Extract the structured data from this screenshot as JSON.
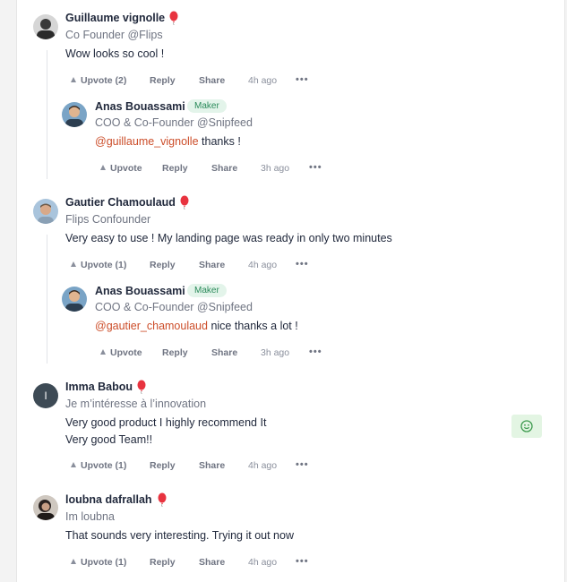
{
  "comments": [
    {
      "author": "Guillaume vignolle",
      "headline": "Co Founder @Flips",
      "text": "Wow looks so cool !",
      "upvote": "Upvote (2)",
      "reply": "Reply",
      "share": "Share",
      "time": "4h ago",
      "reply_item": {
        "author": "Anas Bouassami",
        "badge": "Maker",
        "headline": "COO & Co-Founder @Snipfeed",
        "mention": "@guillaume_vignolle",
        "text": " thanks !",
        "upvote": "Upvote",
        "reply": "Reply",
        "share": "Share",
        "time": "3h ago"
      }
    },
    {
      "author": "Gautier Chamoulaud",
      "headline": "Flips Confounder",
      "text": "Very easy to use ! My landing page was ready in only two minutes",
      "upvote": "Upvote (1)",
      "reply": "Reply",
      "share": "Share",
      "time": "4h ago",
      "reply_item": {
        "author": "Anas Bouassami",
        "badge": "Maker",
        "headline": "COO & Co-Founder @Snipfeed",
        "mention": "@gautier_chamoulaud",
        "text": " nice thanks a lot !",
        "upvote": "Upvote",
        "reply": "Reply",
        "share": "Share",
        "time": "3h ago"
      }
    },
    {
      "author": "Imma Babou",
      "avatar_letter": "I",
      "headline": "Je m’intéresse à l’innovation",
      "text_line1": "Very good product I highly recommend It",
      "text_line2": "Very good Team!!",
      "upvote": "Upvote (1)",
      "reply": "Reply",
      "share": "Share",
      "time": "4h ago"
    },
    {
      "author": "loubna dafrallah",
      "headline": "Im loubna",
      "text": "That sounds very interesting. Trying it out now",
      "upvote": "Upvote (1)",
      "reply": "Reply",
      "share": "Share",
      "time": "4h ago"
    }
  ],
  "more_icon": "•••",
  "icons": {
    "upvote": "upvote-triangle-icon",
    "more": "more-dots-icon",
    "balloon": "red-balloon-icon",
    "react": "smiley-reaction-icon"
  },
  "colors": {
    "mention": "#cc4d29",
    "maker_badge_bg": "#e3f4ea",
    "maker_badge_text": "#2a8a5a",
    "balloon": "#e8333f",
    "react_bg": "#e3f5e3"
  }
}
